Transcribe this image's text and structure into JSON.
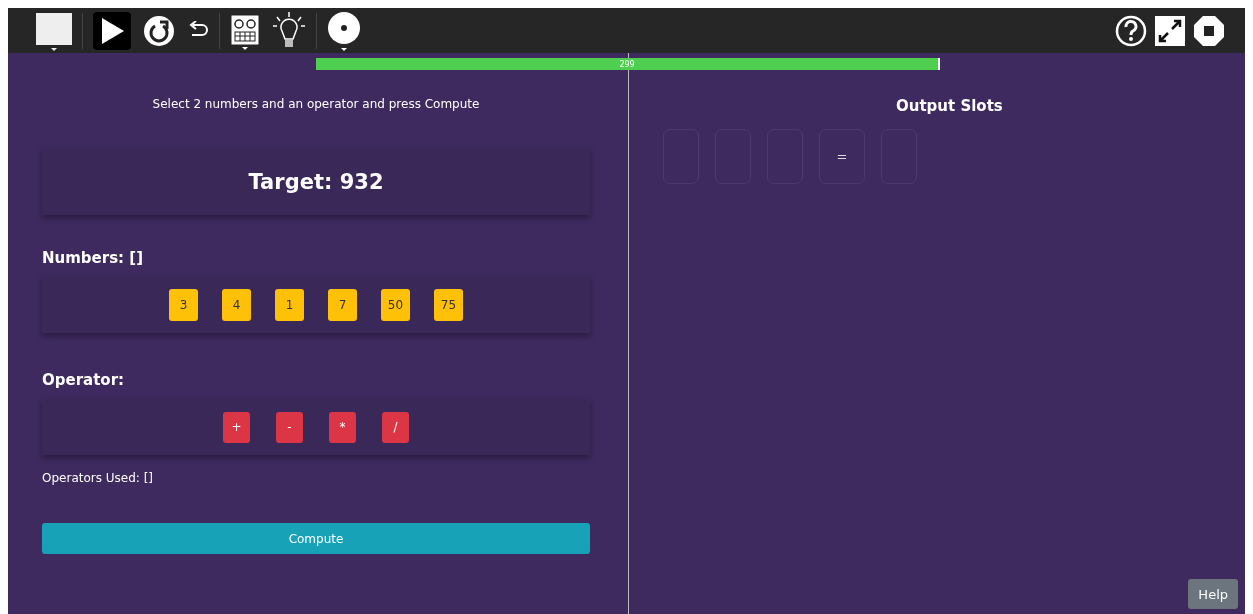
{
  "progress": {
    "label": "299",
    "level": 0.997
  },
  "left": {
    "instruction": "Select 2 numbers and an operator and press Compute",
    "target": "Target: 932",
    "numbers_label": "Numbers: []",
    "numbers": [
      "3",
      "4",
      "1",
      "7",
      "50",
      "75"
    ],
    "operator_label": "Operator:",
    "operators": [
      "+",
      "-",
      "*",
      "/"
    ],
    "operators_used": "Operators Used: []",
    "compute_button": "Compute"
  },
  "right": {
    "title": "Output Slots",
    "slots": [
      {
        "kind": "empty"
      },
      {
        "kind": "empty"
      },
      {
        "kind": "empty"
      },
      {
        "kind": "symbol",
        "text": "="
      },
      {
        "kind": "empty"
      }
    ]
  },
  "help_button": "Help"
}
